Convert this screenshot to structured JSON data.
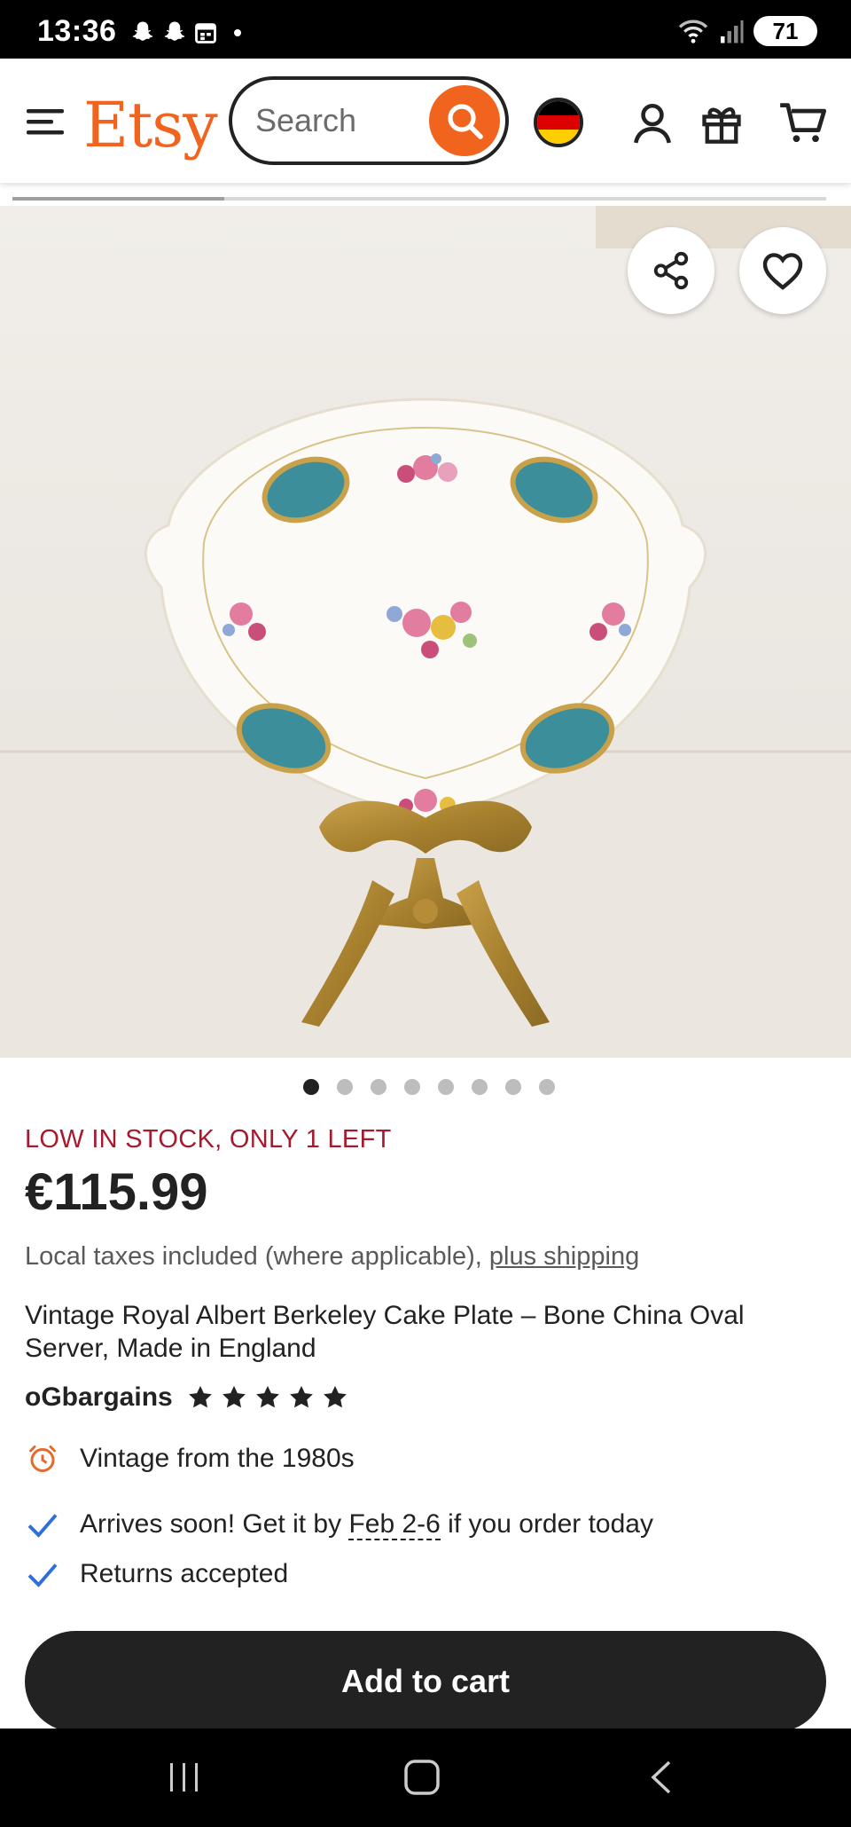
{
  "status_bar": {
    "time": "13:36",
    "battery": "71"
  },
  "header": {
    "logo": "Etsy",
    "search_placeholder": "Search",
    "flag_colors": [
      "#000000",
      "#dd0000",
      "#ffce00"
    ]
  },
  "gallery": {
    "image_alt": "Vintage Royal Albert Berkeley cake plate on gold easel",
    "progress": 0.26,
    "photo_count": 8,
    "active_index": 0
  },
  "listing": {
    "stock_notice": "LOW IN STOCK, ONLY 1 LEFT",
    "price": "€115.99",
    "taxes_text": "Local taxes included (where applicable), ",
    "shipping_link": "plus shipping",
    "title": "Vintage Royal Albert Berkeley Cake Plate – Bone China Oval Server, Made in England",
    "shop_name": "oGbargains",
    "rating_stars": 5,
    "vintage_text": "Vintage from the 1980s",
    "arrival_prefix": "Arrives soon! Get it by ",
    "arrival_dates": "Feb 2-6",
    "arrival_suffix": " if you order today",
    "returns_text": "Returns accepted"
  },
  "cart_button": {
    "label": "Add to cart"
  },
  "colors": {
    "accent": "#f1641e",
    "stock": "#a61a2e",
    "check": "#2f6fdc",
    "dark": "#222222"
  }
}
